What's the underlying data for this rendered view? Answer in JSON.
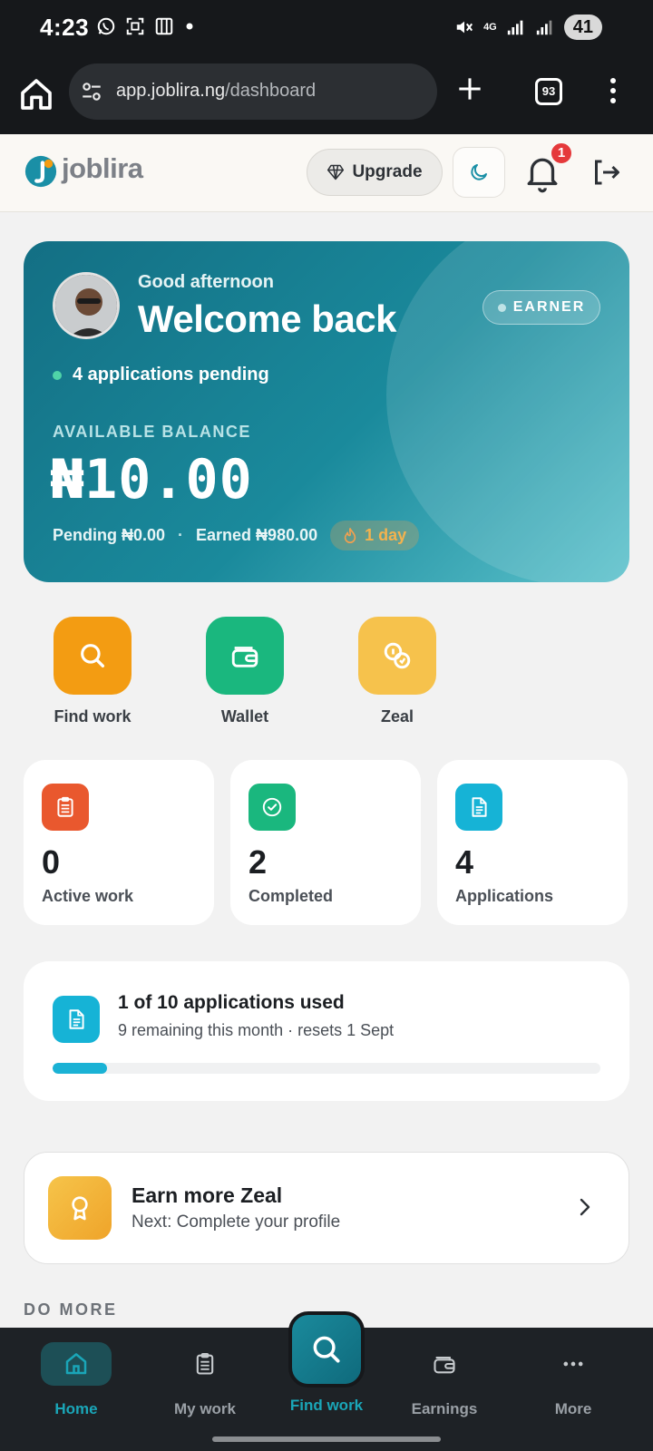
{
  "status_bar": {
    "time": "4:23",
    "network": "4G",
    "battery": "41"
  },
  "browser": {
    "url_host": "app.joblira.ng",
    "url_path": "/dashboard",
    "tab_count": "93"
  },
  "header": {
    "logo_text": "joblira",
    "upgrade_label": "Upgrade",
    "notification_count": "1"
  },
  "hero": {
    "greeting": "Good afternoon",
    "title": "Welcome back",
    "role_badge": "EARNER",
    "pending_apps": "4 applications pending",
    "balance_label": "AVAILABLE BALANCE",
    "balance_value": "₦10.00",
    "pending": "Pending ₦0.00",
    "separator": "·",
    "earned": "Earned ₦980.00",
    "streak": "1 day"
  },
  "quick_actions": [
    {
      "label": "Find work",
      "icon": "search-icon",
      "color": "#f39c12"
    },
    {
      "label": "Wallet",
      "icon": "wallet-icon",
      "color": "#1ab77e"
    },
    {
      "label": "Zeal",
      "icon": "coins-icon",
      "color": "#f6c24c"
    }
  ],
  "stats": [
    {
      "value": "0",
      "label": "Active work",
      "icon": "clipboard-icon",
      "color": "#e9582e"
    },
    {
      "value": "2",
      "label": "Completed",
      "icon": "check-circle-icon",
      "color": "#1ab77e"
    },
    {
      "value": "4",
      "label": "Applications",
      "icon": "document-icon",
      "color": "#16b3d6"
    }
  ],
  "usage": {
    "title": "1 of 10 applications used",
    "subtitle": "9 remaining this month · resets 1 Sept",
    "used": 1,
    "total": 10
  },
  "zeal_card": {
    "title": "Earn more Zeal",
    "subtitle": "Next: Complete your profile"
  },
  "section_label": "DO MORE",
  "bottom_nav": {
    "home": "Home",
    "my_work": "My work",
    "find_work": "Find work",
    "earnings": "Earnings",
    "more": "More"
  }
}
